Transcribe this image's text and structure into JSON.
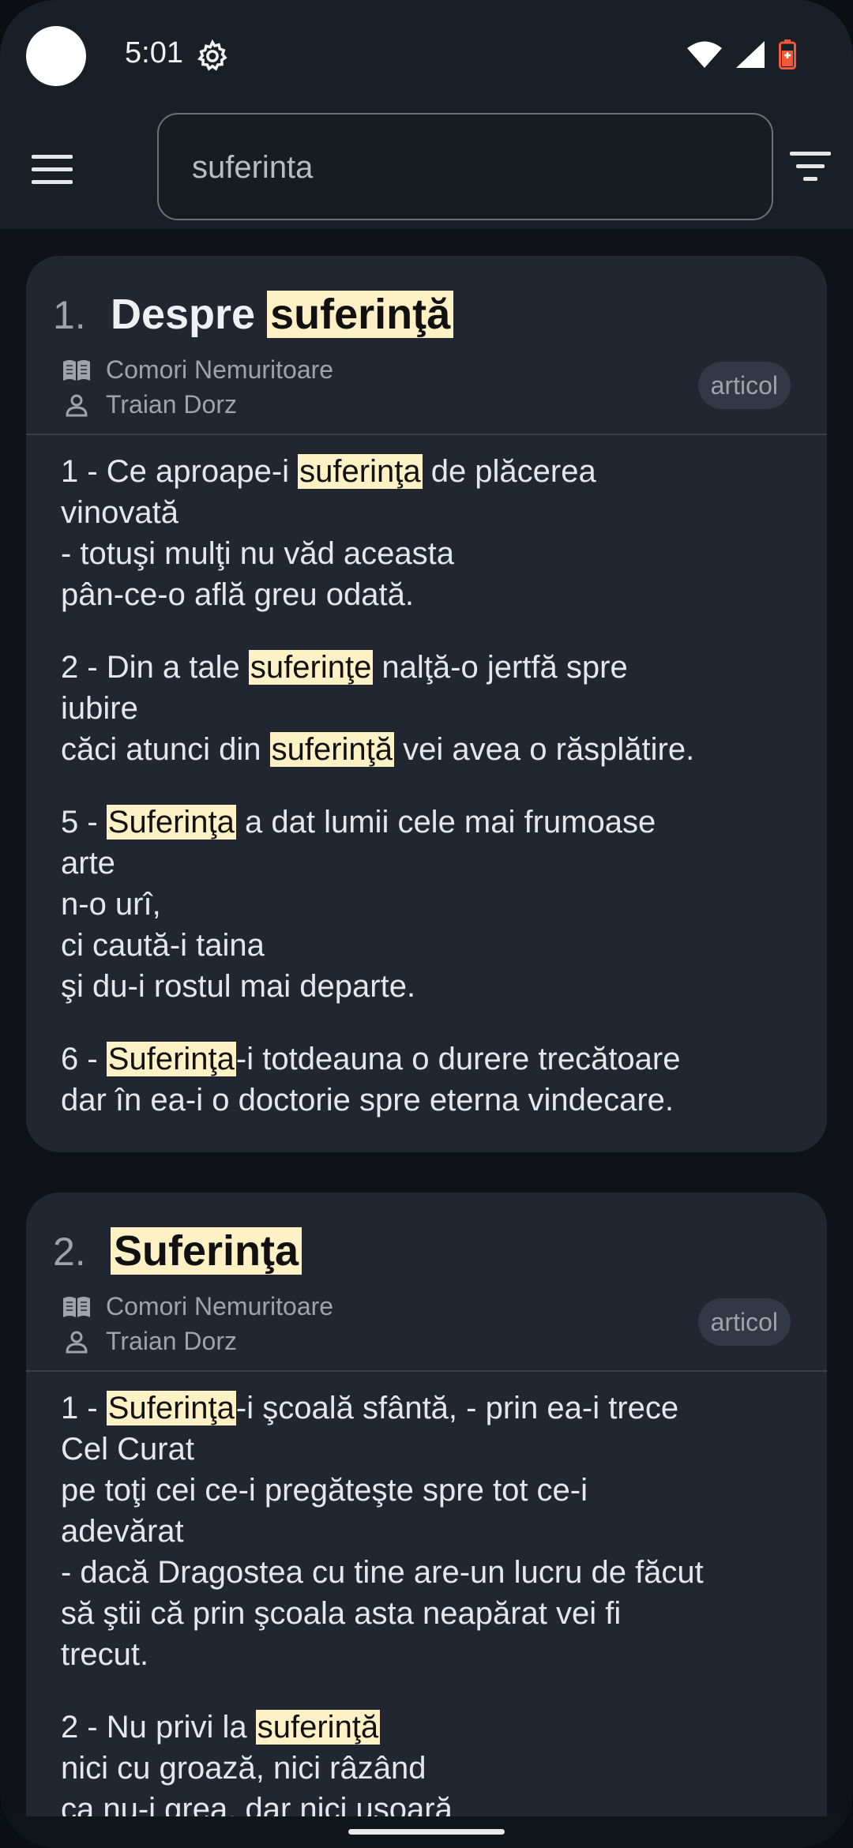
{
  "status_bar": {
    "time": "5:01"
  },
  "search": {
    "value": "suferinta"
  },
  "results": [
    {
      "number": "1.",
      "title_before": "Despre ",
      "title_highlight": "suferinţă",
      "source": "Comori Nemuritoare",
      "author": "Traian Dorz",
      "badge": "articol",
      "verses": [
        [
          "1 - Ce aproape-i ",
          "suferinţa",
          " de plăcerea vinovată\n- totuşi mulţi nu văd aceasta\npân-ce-o află greu odată."
        ],
        [
          "2 - Din a tale ",
          "suferinţe",
          " nalţă-o jertfă spre iubire\ncăci atunci din ",
          "suferinţă",
          " vei avea o răsplătire."
        ],
        [
          "5 - ",
          "Suferinţa",
          " a dat lumii cele mai frumoase arte\nn-o urî,\nci caută-i taina\nşi du-i rostul mai departe."
        ],
        [
          "6 - ",
          "Suferinţa",
          "-i totdeauna o durere trecătoare\ndar în ea-i o doctorie spre eterna vindecare."
        ]
      ]
    },
    {
      "number": "2.",
      "title_before": "",
      "title_highlight": "Suferinţa",
      "source": "Comori Nemuritoare",
      "author": "Traian Dorz",
      "badge": "articol",
      "verses": [
        [
          "1 - ",
          "Suferinţa",
          "-i şcoală sfântă, - prin ea-i trece Cel Curat\npe toţi cei ce-i pregăteşte spre tot ce-i adevărat\n- dacă Dragostea cu tine are-un lucru de făcut\nsă ştii că prin şcoala asta neapărat vei fi trecut."
        ],
        [
          "2 - Nu privi la ",
          "suferinţă",
          "\nnici cu groază, nici râzând\nca nu-i grea, dar nici uşoară"
        ]
      ]
    }
  ]
}
